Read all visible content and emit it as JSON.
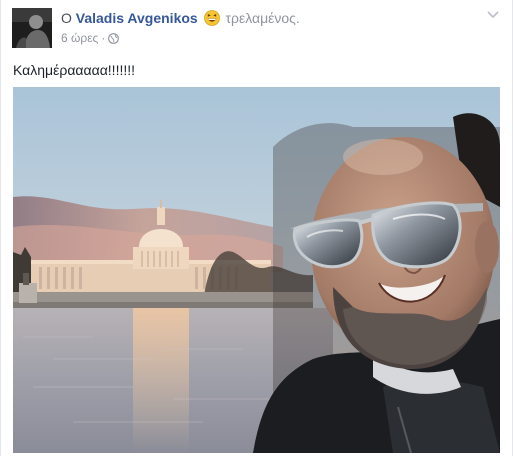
{
  "post": {
    "author_prefix": "Ο",
    "author_name": "Valadis Avgenikos",
    "feeling_icon": "laughing-emoji",
    "feeling_text": "τρελαμένος.",
    "timestamp": "6 ώρες",
    "separator": "·",
    "privacy_icon": "globe-icon",
    "menu_icon": "chevron-down-icon",
    "status_text": "Καλημέρααααα!!!!!!!",
    "photo_description_icon": "selfie-photo"
  },
  "colors": {
    "author_link": "#365899",
    "meta_text": "#90949c",
    "body_text": "#1d2129"
  }
}
